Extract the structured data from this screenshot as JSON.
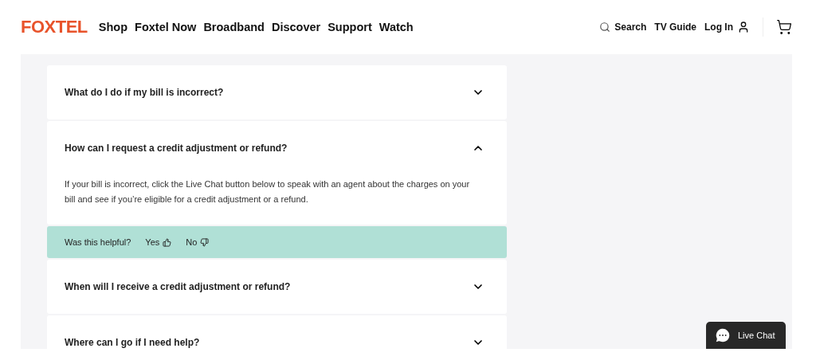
{
  "header": {
    "logo": "FOXTEL",
    "nav": [
      "Shop",
      "Foxtel Now",
      "Broadband",
      "Discover",
      "Support",
      "Watch"
    ],
    "search": "Search",
    "tv_guide": "TV Guide",
    "login": "Log In"
  },
  "faq": [
    {
      "question": "What do I do if my bill is incorrect?",
      "expanded": false
    },
    {
      "question": "How can I request a credit adjustment or refund?",
      "expanded": true,
      "answer": "If your bill is incorrect, click the Live Chat button below to speak with an agent about the charges on your bill and see if you’re eligible for a credit adjustment or a refund.",
      "feedback": {
        "prompt": "Was this helpful?",
        "yes": "Yes",
        "no": "No"
      }
    },
    {
      "question": "When will I receive a credit adjustment or refund?",
      "expanded": false
    },
    {
      "question": "Where can I go if I need help?",
      "expanded": false
    }
  ],
  "live_chat": "Live Chat"
}
